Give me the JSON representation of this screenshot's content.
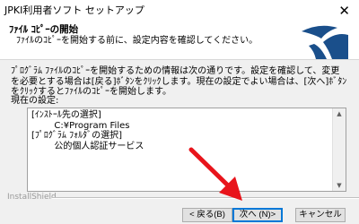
{
  "window": {
    "title": "JPKI利用者ソフト セットアップ",
    "close_symbol": "✕"
  },
  "header": {
    "title": "ﾌｧｲﾙ ｺﾋﾟｰの開始",
    "subtitle": "ﾌｧｲﾙのｺﾋﾟｰを開始する前に、設定内容を確認してください。",
    "logo_icon": "installshield-logo-icon"
  },
  "content": {
    "description": "ﾌﾟﾛｸﾞﾗﾑ ﾌｧｲﾙのｺﾋﾟｰを開始するための情報は次の通りです。設定を確認して、変更を必要とする場合は[戻る]ﾎﾞﾀﾝをｸﾘｯｸします。現在の設定でよい場合は、[次へ]ﾎﾞﾀﾝをｸﾘｯｸするとﾌｧｲﾙのｺﾋﾟｰを開始します。",
    "settings_label": "現在の設定:",
    "settings_lines": [
      "[ｲﾝｽﾄｰﾙ先の選択]",
      "        C:¥Program Files",
      "[ﾌﾟﾛｸﾞﾗﾑ ﾌｫﾙﾀﾞの選択]",
      "        公的個人認証サービス"
    ]
  },
  "footer": {
    "brand": "InstallShield",
    "back_label": "< 戻る(B)",
    "next_label": "次へ (N)>",
    "cancel_label": "キャンセル"
  },
  "colors": {
    "logo": "#1a4f8b",
    "annotation_arrow": "#e8141b",
    "default_button_border": "#0078d7"
  }
}
